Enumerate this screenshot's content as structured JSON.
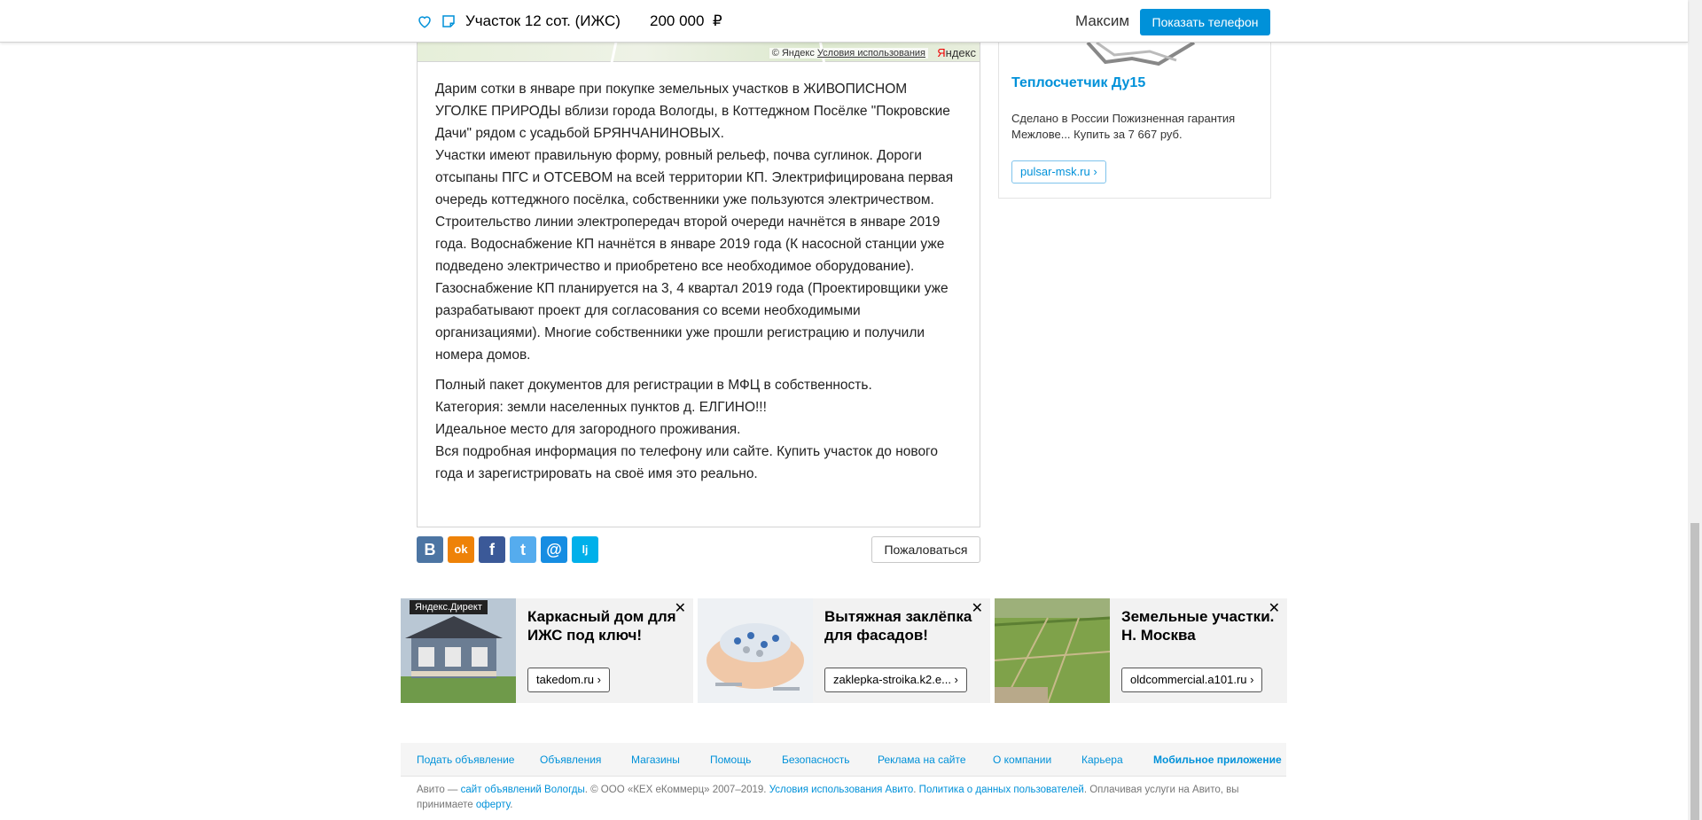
{
  "topbar": {
    "title": "Участок 12 сот. (ИЖС)",
    "price": "200 000",
    "currency": "₽",
    "user": "Максим",
    "phone_button": "Показать телефон",
    "favorite_icon": "heart-icon",
    "note_icon": "note-icon"
  },
  "map": {
    "copyright": "© Яндекс",
    "terms_link": "Условия использования",
    "logo_a": "Я",
    "logo_b": "ндекс"
  },
  "description": {
    "paragraph1": "Дарим сотки в январе при покупке земельных участков в ЖИВОПИСНОМ УГОЛКЕ ПРИРОДЫ вблизи города Вологды, в Коттеджном Посёлке \"Покровские Дачи\" рядом с усадьбой БРЯНЧАНИНОВЫХ.\nУчастки имеют правильную форму, ровный рельеф, почва суглинок. Дороги отсыпаны ПГС и ОТСЕВОМ на всей территории КП. Электрифицирована первая очередь коттеджного посёлка, собственники уже пользуются электричеством.\nСтроительство линии электропередач второй очереди начнётся в январе 2019 года. Водоснабжение КП начнётся в январе 2019 года (К насосной станции уже подведено электричество и приобретено все необходимое оборудование).\nГазоснабжение КП планируется на 3, 4 квартал 2019 года (Проектировщики уже разрабатывают проект для согласования со всеми необходимыми организациями). Многие собственники уже прошли регистрацию и получили номера домов.",
    "paragraph2": "Полный пакет документов для регистрации в МФЦ в собственность.\nКатегория: земли населенных пунктов д. ЕЛГИНО!!!\nИдеальное место для загородного проживания.\nВся подробная информация по телефону или сайте. Купить участок до нового года и зарегистрировать на своё имя это реально."
  },
  "share": {
    "vk": "B",
    "ok": "ok",
    "fb": "f",
    "tw": "t",
    "mail": "@",
    "lj": "lj",
    "complain_button": "Пожаловаться"
  },
  "side_ad": {
    "title": "Теплосчетчик Ду15",
    "text": "Сделано в России Пожизненная гарантия Межлове... Купить за 7 667 руб.",
    "domain": "pulsar-msk.ru ›"
  },
  "bottom_ads": [
    {
      "badge": "Яндекс.Директ",
      "headline": "Каркасный дом для ИЖС под ключ!",
      "domain": "takedom.ru ›",
      "close": "✕"
    },
    {
      "headline": "Вытяжная заклёпка для фасадов!",
      "domain": "zaklepka-stroika.k2.e... ›",
      "close": "✕"
    },
    {
      "headline": "Земельные участки. Н. Москва",
      "domain": "oldcommercial.a101.ru ›",
      "close": "✕"
    }
  ],
  "footer": {
    "nav": [
      "Подать объявление",
      "Объявления",
      "Магазины",
      "Помощь",
      "Безопасность",
      "Реклама на сайте",
      "О компании",
      "Карьера",
      "Мобильное приложение"
    ],
    "text_prefix": "Авито — ",
    "link_site": "сайт объявлений Вологды",
    "text_mid": ". © ООО «КЕХ еКоммерц» 2007–2019. ",
    "link_terms": "Условия использования Авито",
    "sep": ". ",
    "link_privacy": "Политика о данных пользователей",
    "text_end": ". Оплачивая услуги на Авито, вы принимаете ",
    "link_offer": "оферту",
    "dot": "."
  },
  "colors": {
    "accent": "#0091d9",
    "vk": "#4c75a3",
    "ok": "#ee8208",
    "fb": "#3b5998",
    "tw": "#55acee",
    "mail": "#168de2",
    "lj": "#00b0ea"
  }
}
